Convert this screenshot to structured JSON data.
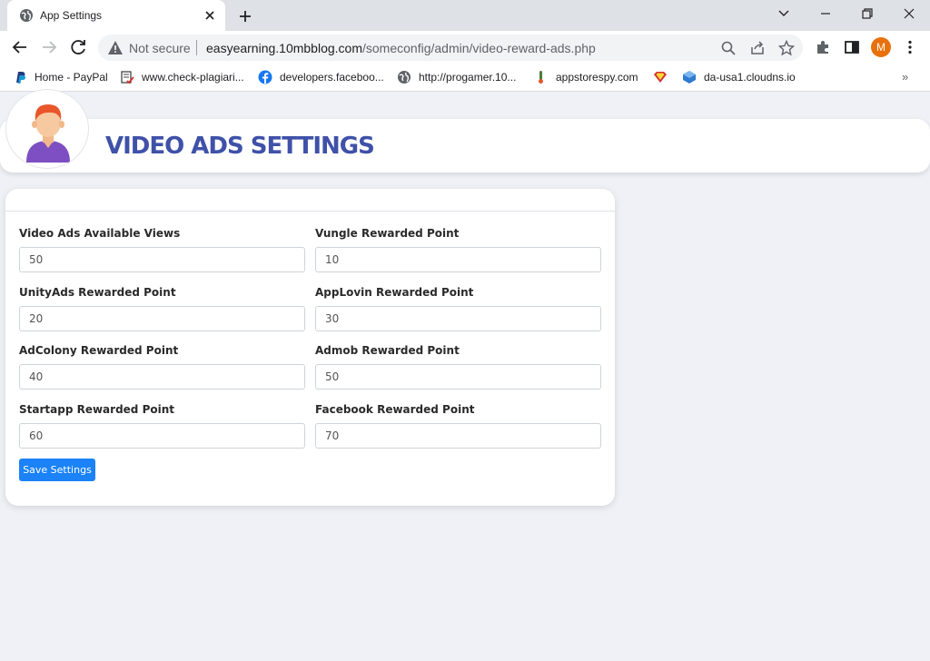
{
  "browser": {
    "tab_title": "App Settings",
    "url_host": "easyearning.10mbblog.com",
    "url_path": "/someconfig/admin/video-reward-ads.php",
    "security_label": "Not secure",
    "profile_initial": "M",
    "bookmarks": [
      {
        "label": "Home - PayPal",
        "icon": "paypal-icon"
      },
      {
        "label": "www.check-plagiari...",
        "icon": "plagiarism-icon"
      },
      {
        "label": "developers.faceboo...",
        "icon": "facebook-icon"
      },
      {
        "label": "http://progamer.10...",
        "icon": "globe-icon"
      },
      {
        "label": "appstorespy.com",
        "icon": "appstorespy-icon"
      },
      {
        "label": "",
        "icon": "superman-icon"
      },
      {
        "label": "da-usa1.cloudns.io",
        "icon": "cloudns-icon"
      }
    ],
    "overflow_glyph": "»"
  },
  "page": {
    "title": "VIDEO ADS SETTINGS",
    "save_label": "Save Settings"
  },
  "fields": [
    {
      "label": "Video Ads Available Views",
      "value": "50"
    },
    {
      "label": "Vungle Rewarded Point",
      "value": "10"
    },
    {
      "label": "UnityAds Rewarded Point",
      "value": "20"
    },
    {
      "label": "AppLovin Rewarded Point",
      "value": "30"
    },
    {
      "label": "AdColony Rewarded Point",
      "value": "40"
    },
    {
      "label": "Admob Rewarded Point",
      "value": "50"
    },
    {
      "label": "Startapp Rewarded Point",
      "value": "60"
    },
    {
      "label": "Facebook Rewarded Point",
      "value": "70"
    }
  ],
  "colors": {
    "title": "#3f51a8",
    "button": "#1b82f7",
    "page_background": "#eff1f6"
  }
}
